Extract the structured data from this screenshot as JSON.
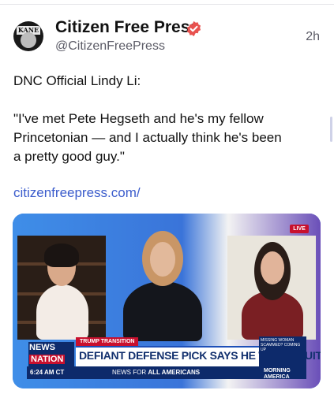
{
  "post": {
    "display_name": "Citizen Free Press",
    "handle": "@CitizenFreePress",
    "timestamp": "2h",
    "avatar_text": "KANE",
    "lines": [
      "DNC Official Lindy Li:",
      "",
      "\"I've met Pete Hegseth and he's my fellow",
      "Princetonian — and I actually think he's been",
      "a pretty good guy.\""
    ],
    "link": "citizenfreepress.com/",
    "icons": [
      "verified-badge-icon"
    ],
    "colors": {
      "verified": "#e8524f",
      "link": "#3b5ccc"
    }
  },
  "video": {
    "live_label": "LIVE",
    "segment_tag": "TRUMP TRANSITION",
    "headline": "DEFIANT DEFENSE PICK SAYS HE WON'T QUIT",
    "network_top": "NEWS",
    "network_bottom": "NATION",
    "time": "6:24 AM CT",
    "tagline_prefix": "NEWS FOR ",
    "tagline_bold": "ALL AMERICANS",
    "promo_text": "MISSING WOMAN SCAMMED? COMING UP",
    "promo_show_line1": "MORNING",
    "promo_show_line2": "AMERICA"
  }
}
